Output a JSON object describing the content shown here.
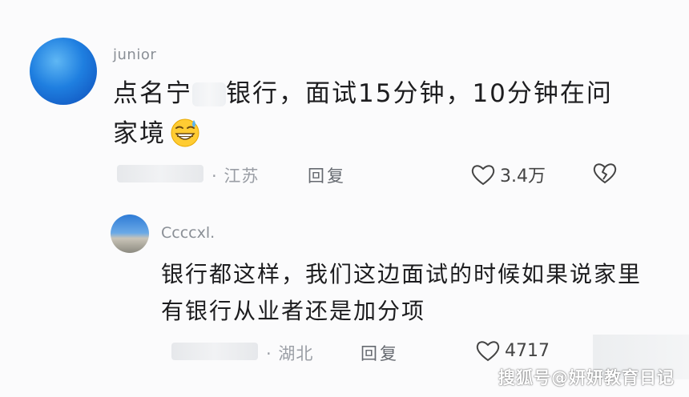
{
  "main_comment": {
    "username": "junior",
    "text_part1": "点名宁",
    "text_part2": "银行，面试15分钟，10分钟在问家境",
    "location": "· 江苏",
    "reply_label": "回复",
    "like_count": "3.4万"
  },
  "reply_comment": {
    "username": "Ccccxl.",
    "text": "银行都这样，我们这边面试的时候如果说家里有银行从业者还是加分项",
    "location": "· 湖北",
    "reply_label": "回复",
    "like_count": "4717"
  },
  "watermark": "搜狐号@妍妍教育日记",
  "icons": {
    "like": "heart-icon",
    "dislike": "broken-heart-icon",
    "emoji": "grinning-sweat-emoji"
  },
  "colors": {
    "avatar_main": "#1f7fe0",
    "meta_gray": "#9a9ea5",
    "text": "#1d1d1f"
  }
}
